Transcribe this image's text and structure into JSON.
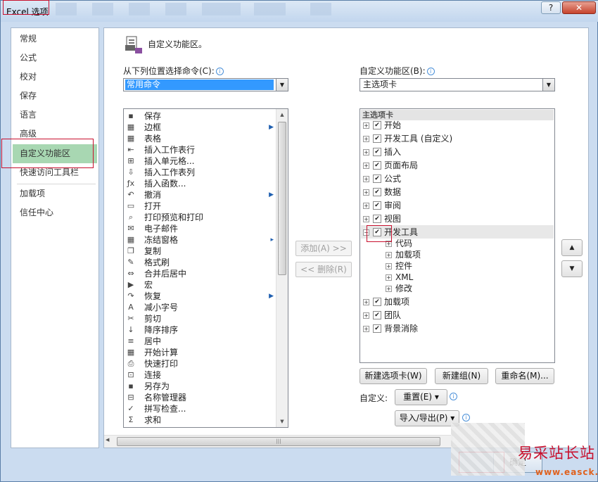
{
  "window": {
    "title": "Excel 选项",
    "help": "?",
    "close": "✕"
  },
  "sidebar": {
    "items": [
      {
        "label": "常规"
      },
      {
        "label": "公式"
      },
      {
        "label": "校对"
      },
      {
        "label": "保存"
      },
      {
        "label": "语言"
      },
      {
        "label": "高级"
      },
      {
        "label": "自定义功能区"
      },
      {
        "label": "快速访问工具栏"
      },
      {
        "label": "加载项"
      },
      {
        "label": "信任中心"
      }
    ],
    "selected": "自定义功能区"
  },
  "header": {
    "title": "自定义功能区。"
  },
  "left": {
    "label": "从下列位置选择命令(C):",
    "combo_value": "常用命令"
  },
  "right": {
    "label": "自定义功能区(B):",
    "combo_value": "主选项卡"
  },
  "commands": [
    {
      "label": "保存",
      "icon": "save-icon",
      "glyph": "▪",
      "sub": ""
    },
    {
      "label": "边框",
      "icon": "border-icon",
      "glyph": "▦",
      "sub": "▶"
    },
    {
      "label": "表格",
      "icon": "table-icon",
      "glyph": "▦",
      "sub": ""
    },
    {
      "label": "插入工作表行",
      "icon": "insert-row-icon",
      "glyph": "⇤",
      "sub": ""
    },
    {
      "label": "插入单元格...",
      "icon": "insert-cell-icon",
      "glyph": "⊞",
      "sub": ""
    },
    {
      "label": "插入工作表列",
      "icon": "insert-col-icon",
      "glyph": "⇩",
      "sub": ""
    },
    {
      "label": "插入函数...",
      "icon": "function-icon",
      "glyph": "ƒx",
      "sub": ""
    },
    {
      "label": "撤消",
      "icon": "undo-icon",
      "glyph": "↶",
      "sub": "▶"
    },
    {
      "label": "打开",
      "icon": "open-folder-icon",
      "glyph": "▭",
      "sub": ""
    },
    {
      "label": "打印预览和打印",
      "icon": "print-preview-icon",
      "glyph": "⌕",
      "sub": ""
    },
    {
      "label": "电子邮件",
      "icon": "email-icon",
      "glyph": "✉",
      "sub": ""
    },
    {
      "label": "冻结窗格",
      "icon": "freeze-panes-icon",
      "glyph": "▦",
      "sub": "▸"
    },
    {
      "label": "复制",
      "icon": "copy-icon",
      "glyph": "❐",
      "sub": ""
    },
    {
      "label": "格式刷",
      "icon": "format-painter-icon",
      "glyph": "✎",
      "sub": ""
    },
    {
      "label": "合并后居中",
      "icon": "merge-center-icon",
      "glyph": "⇔",
      "sub": ""
    },
    {
      "label": "宏",
      "icon": "macro-icon",
      "glyph": "▶",
      "sub": ""
    },
    {
      "label": "恢复",
      "icon": "redo-icon",
      "glyph": "↷",
      "sub": "▶"
    },
    {
      "label": "减小字号",
      "icon": "decrease-font-icon",
      "glyph": "A",
      "sub": ""
    },
    {
      "label": "剪切",
      "icon": "cut-icon",
      "glyph": "✂",
      "sub": ""
    },
    {
      "label": "降序排序",
      "icon": "sort-desc-icon",
      "glyph": "↓",
      "sub": ""
    },
    {
      "label": "居中",
      "icon": "align-center-icon",
      "glyph": "≡",
      "sub": ""
    },
    {
      "label": "开始计算",
      "icon": "calculator-icon",
      "glyph": "▦",
      "sub": ""
    },
    {
      "label": "快速打印",
      "icon": "quick-print-icon",
      "glyph": "⎙",
      "sub": ""
    },
    {
      "label": "连接",
      "icon": "connections-icon",
      "glyph": "⊡",
      "sub": ""
    },
    {
      "label": "另存为",
      "icon": "save-as-icon",
      "glyph": "▪",
      "sub": ""
    },
    {
      "label": "名称管理器",
      "icon": "name-manager-icon",
      "glyph": "⊟",
      "sub": ""
    },
    {
      "label": "拼写检查...",
      "icon": "spelling-icon",
      "glyph": "✓",
      "sub": ""
    },
    {
      "label": "求和",
      "icon": "sum-icon",
      "glyph": "Σ",
      "sub": ""
    }
  ],
  "middle": {
    "add": "添加(A) >>",
    "remove": "<< 删除(R)"
  },
  "tree": {
    "header": "主选项卡",
    "top": [
      {
        "label": "开始",
        "checked": true
      },
      {
        "label": "开发工具 (自定义)",
        "checked": true
      },
      {
        "label": "插入",
        "checked": true
      },
      {
        "label": "页面布局",
        "checked": true
      },
      {
        "label": "公式",
        "checked": true
      },
      {
        "label": "数据",
        "checked": true
      },
      {
        "label": "审阅",
        "checked": true
      },
      {
        "label": "视图",
        "checked": true
      },
      {
        "label": "开发工具",
        "checked": true,
        "expanded": true
      }
    ],
    "groups": [
      {
        "label": "代码"
      },
      {
        "label": "加载项"
      },
      {
        "label": "控件"
      },
      {
        "label": "XML"
      },
      {
        "label": "修改"
      }
    ],
    "bottom": [
      {
        "label": "加载项",
        "checked": true
      },
      {
        "label": "团队",
        "checked": true
      },
      {
        "label": "背景消除",
        "checked": true
      }
    ],
    "expand_glyph": "+",
    "collapse_glyph": "−",
    "check_glyph": "✔"
  },
  "buttons": {
    "new_tab": "新建选项卡(W)",
    "new_group": "新建组(N)",
    "rename": "重命名(M)...",
    "custom_label": "自定义:",
    "reset": "重置(E) ▾",
    "import_export": "导入/导出(P) ▾",
    "ok": "确定"
  },
  "watermark": {
    "logo": "易采站长站",
    "url": "www.easck.com"
  },
  "colors": {
    "selection": "#3399ff",
    "nav_selected": "#a8d7b2",
    "highlight_box": "#c8102e"
  }
}
